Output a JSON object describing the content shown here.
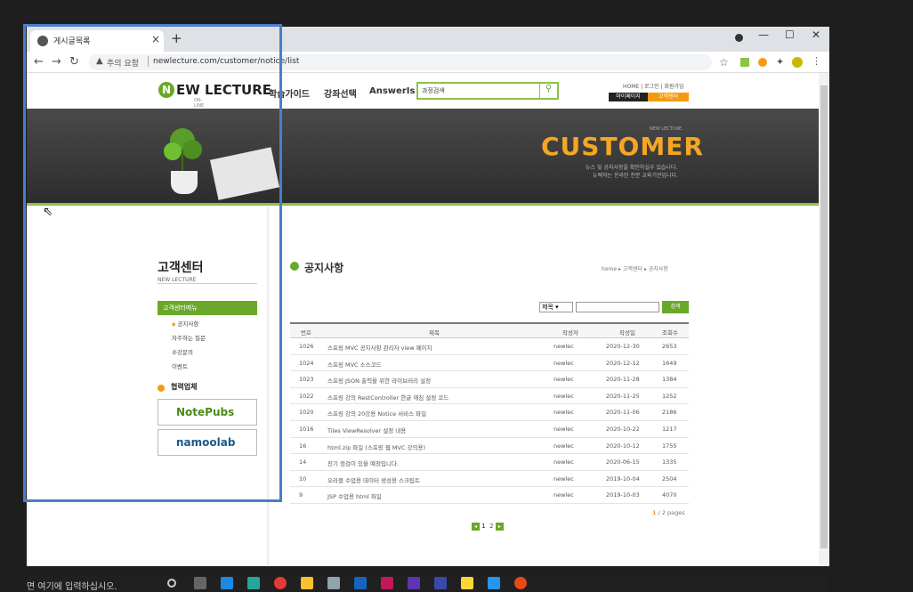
{
  "browser": {
    "tab_title": "게시글목록",
    "url_warning": "주의 요함",
    "url": "newlecture.com/customer/notice/list",
    "new_tab": "+",
    "close": "×",
    "minimize": "—",
    "maximize": "☐",
    "close_window": "✕"
  },
  "site": {
    "logo_text": "EW LECTURE",
    "logo_letter": "N",
    "logo_sub": "ON-LINE",
    "nav": [
      "학습가이드",
      "강좌선택",
      "AnswerIs"
    ],
    "search_value": "과정검색",
    "util_links": "HOME | 로그인 | 회원가입",
    "my_page": "마이페이지",
    "customer_center_btn": "고객센터"
  },
  "banner": {
    "small": "NEW LECTURE",
    "title": "CUSTOMER",
    "desc1": "뉴스 및 공지사항을 확인하실수 있습니다.",
    "desc2": "뉴렉처는 온라인 전문 교육기관입니다."
  },
  "sidebar": {
    "title": "고객센터",
    "subtitle": "NEW LECTURE",
    "menu_header": "고객센터메뉴",
    "items": [
      "공지사항",
      "자주하는 질문",
      "수강문의",
      "이벤트"
    ],
    "partner_title": "협력업체",
    "partners": [
      "NotePubs",
      "namoolab"
    ]
  },
  "main": {
    "title": "공지사항",
    "breadcrumb": "home ▸ 고객센터 ▸ 공지사항",
    "search_field": "제목",
    "search_button": "검색",
    "columns": [
      "번호",
      "제목",
      "작성자",
      "작성일",
      "조회수"
    ],
    "rows": [
      [
        "1026",
        "스프링 MVC 공지사항 관리자 view 페이지",
        "newlec",
        "2020-12-30",
        "2653"
      ],
      [
        "1024",
        "스프링 MVC 소스코드",
        "newlec",
        "2020-12-12",
        "1649"
      ],
      [
        "1023",
        "스프링 JSON 출력을 위한 라이브러리 설정",
        "newlec",
        "2020-11-28",
        "1384"
      ],
      [
        "1022",
        "스프링 강의 RestController 한글 깨짐 설정 코드",
        "newlec",
        "2020-11-25",
        "1252"
      ],
      [
        "1020",
        "스프링 강의 20강용 Notice 서비스 파일",
        "newlec",
        "2020-11-06",
        "2186"
      ],
      [
        "1016",
        "Tiles ViewResolver 설정 내용",
        "newlec",
        "2020-10-22",
        "1217"
      ],
      [
        "16",
        "html.zip 파일 (스프링 웹 MVC 강의용)",
        "newlec",
        "2020-10-12",
        "1755"
      ],
      [
        "14",
        "전기 점검이 있을 예정입니다.",
        "newlec",
        "2020-06-15",
        "1335"
      ],
      [
        "10",
        "오라클 수업용 데이터 생성용 스크립트",
        "newlec",
        "2019-10-04",
        "2504"
      ],
      [
        "9",
        "JSP 수업용 html 파일",
        "newlec",
        "2019-10-03",
        "4070"
      ]
    ],
    "page_current": "1",
    "page_total": " / 2 pages",
    "pages": [
      "1",
      "2"
    ]
  },
  "taskbar": {
    "search_placeholder": "면 여기에 입력하십시오."
  }
}
